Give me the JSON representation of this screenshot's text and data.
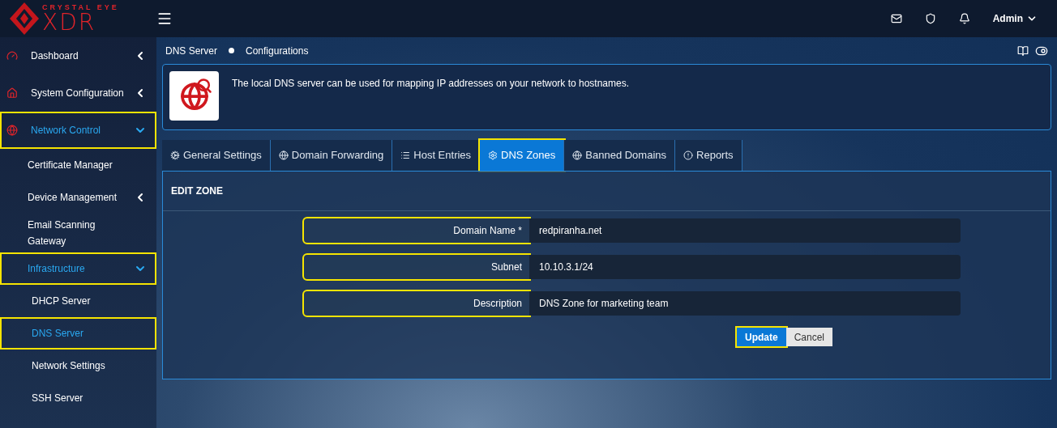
{
  "logo": {
    "tagline": "CRYSTAL EYE",
    "name": "XDR"
  },
  "header": {
    "user": "Admin"
  },
  "sidebar": {
    "items": [
      {
        "label": "Dashboard",
        "expanded": false,
        "highlighted": false,
        "selected": false
      },
      {
        "label": "System Configuration",
        "expanded": false,
        "highlighted": false,
        "selected": false
      },
      {
        "label": "Network Control",
        "expanded": true,
        "highlighted": true,
        "selected": true,
        "children": [
          {
            "label": "Certificate Manager",
            "highlighted": false,
            "selected": false
          },
          {
            "label": "Device Management",
            "expanded": false,
            "highlighted": false,
            "selected": false
          },
          {
            "label": "Email Scanning Gateway",
            "highlighted": false,
            "selected": false
          },
          {
            "label": "Infrastructure",
            "expanded": true,
            "highlighted": true,
            "selected": true,
            "children": [
              {
                "label": "DHCP Server",
                "highlighted": false,
                "selected": false
              },
              {
                "label": "DNS Server",
                "highlighted": true,
                "selected": true
              },
              {
                "label": "Network Settings",
                "highlighted": false,
                "selected": false
              },
              {
                "label": "SSH Server",
                "highlighted": false,
                "selected": false
              }
            ]
          }
        ]
      }
    ]
  },
  "breadcrumb": [
    "DNS Server",
    "Configurations"
  ],
  "info": {
    "text": "The local DNS server can be used for mapping IP addresses on your network to hostnames."
  },
  "tabs": [
    {
      "label": "General Settings",
      "selected": false,
      "highlighted": false
    },
    {
      "label": "Domain Forwarding",
      "selected": false,
      "highlighted": false
    },
    {
      "label": "Host Entries",
      "selected": false,
      "highlighted": false
    },
    {
      "label": "DNS Zones",
      "selected": true,
      "highlighted": true
    },
    {
      "label": "Banned Domains",
      "selected": false,
      "highlighted": false
    },
    {
      "label": "Reports",
      "selected": false,
      "highlighted": false
    }
  ],
  "panel": {
    "title": "EDIT ZONE",
    "fields": [
      {
        "label": "Domain Name *",
        "value": "redpiranha.net",
        "highlighted": true
      },
      {
        "label": "Subnet",
        "value": "10.10.3.1/24",
        "highlighted": true
      },
      {
        "label": "Description",
        "value": "DNS Zone for marketing team",
        "highlighted": true
      }
    ],
    "buttons": [
      {
        "label": "Update",
        "kind": "primary",
        "highlighted": true
      },
      {
        "label": "Cancel",
        "kind": "default",
        "highlighted": false
      }
    ]
  }
}
